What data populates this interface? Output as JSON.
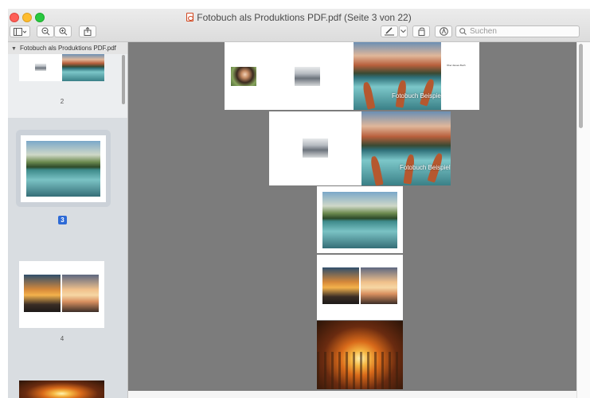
{
  "window": {
    "title": "Fotobuch als Produktions PDF.pdf (Seite 3 von 22)"
  },
  "toolbar": {
    "sidebar_toggle_icon": "sidebar-icon",
    "zoom_out_icon": "zoom-out-icon",
    "zoom_in_icon": "zoom-in-icon",
    "share_icon": "share-icon",
    "markup_icon": "pen-icon",
    "rotate_icon": "rotate-icon",
    "annotate_icon": "annotate-icon",
    "search_placeholder": "Suchen"
  },
  "sidebar": {
    "document_name": "Fotobuch als Produktions PDF.pdf",
    "pages": [
      {
        "number": "2"
      },
      {
        "number": "3",
        "selected": true
      },
      {
        "number": "4"
      }
    ]
  },
  "document": {
    "spread_caption": "Fotobuch Beispiel",
    "small_caption": "Über dieses Buch"
  },
  "colors": {
    "accent": "#2d6ad6",
    "canvas": "#7c7c7c",
    "sidebar": "#d9dde1"
  }
}
